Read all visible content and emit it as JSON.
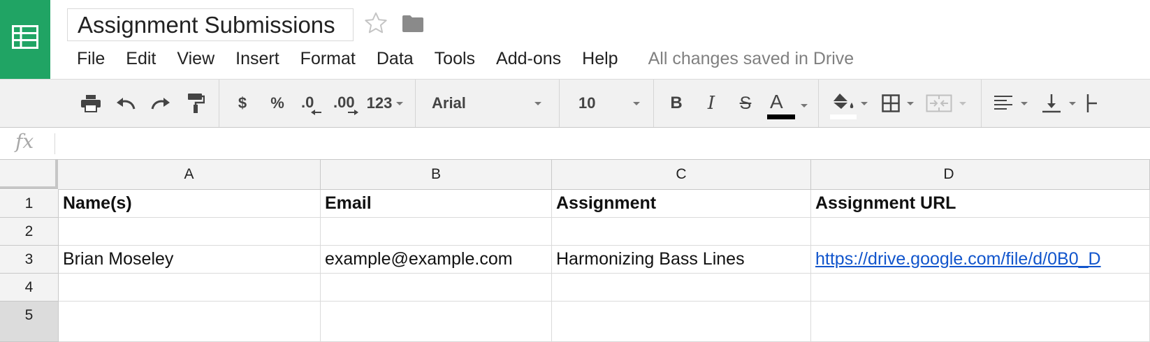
{
  "app": {
    "title": "Assignment Submissions"
  },
  "menu": {
    "items": [
      "File",
      "Edit",
      "View",
      "Insert",
      "Format",
      "Data",
      "Tools",
      "Add-ons",
      "Help"
    ],
    "status": "All changes saved in Drive"
  },
  "toolbar": {
    "currency": "$",
    "percent": "%",
    "decrease_decimal": ".0",
    "increase_decimal": ".00",
    "more_formats": "123",
    "font": "Arial",
    "font_size": "10",
    "bold": "B",
    "italic": "I",
    "strikethrough": "S",
    "text_color": "A"
  },
  "formula_bar": {
    "label": "fx",
    "value": ""
  },
  "grid": {
    "columns": [
      "A",
      "B",
      "C",
      "D"
    ],
    "rows": [
      "1",
      "2",
      "3",
      "4",
      "5"
    ],
    "cells": [
      [
        "Name(s)",
        "Email",
        "Assignment",
        "Assignment URL"
      ],
      [
        "",
        "",
        "",
        ""
      ],
      [
        "Brian Moseley",
        "example@example.com",
        "Harmonizing Bass Lines",
        "https://drive.google.com/file/d/0B0_D"
      ],
      [
        "",
        "",
        "",
        ""
      ],
      [
        "",
        "",
        "",
        ""
      ]
    ]
  },
  "colors": {
    "brand": "#20a464",
    "link": "#1155cc",
    "status_text": "#808080"
  }
}
